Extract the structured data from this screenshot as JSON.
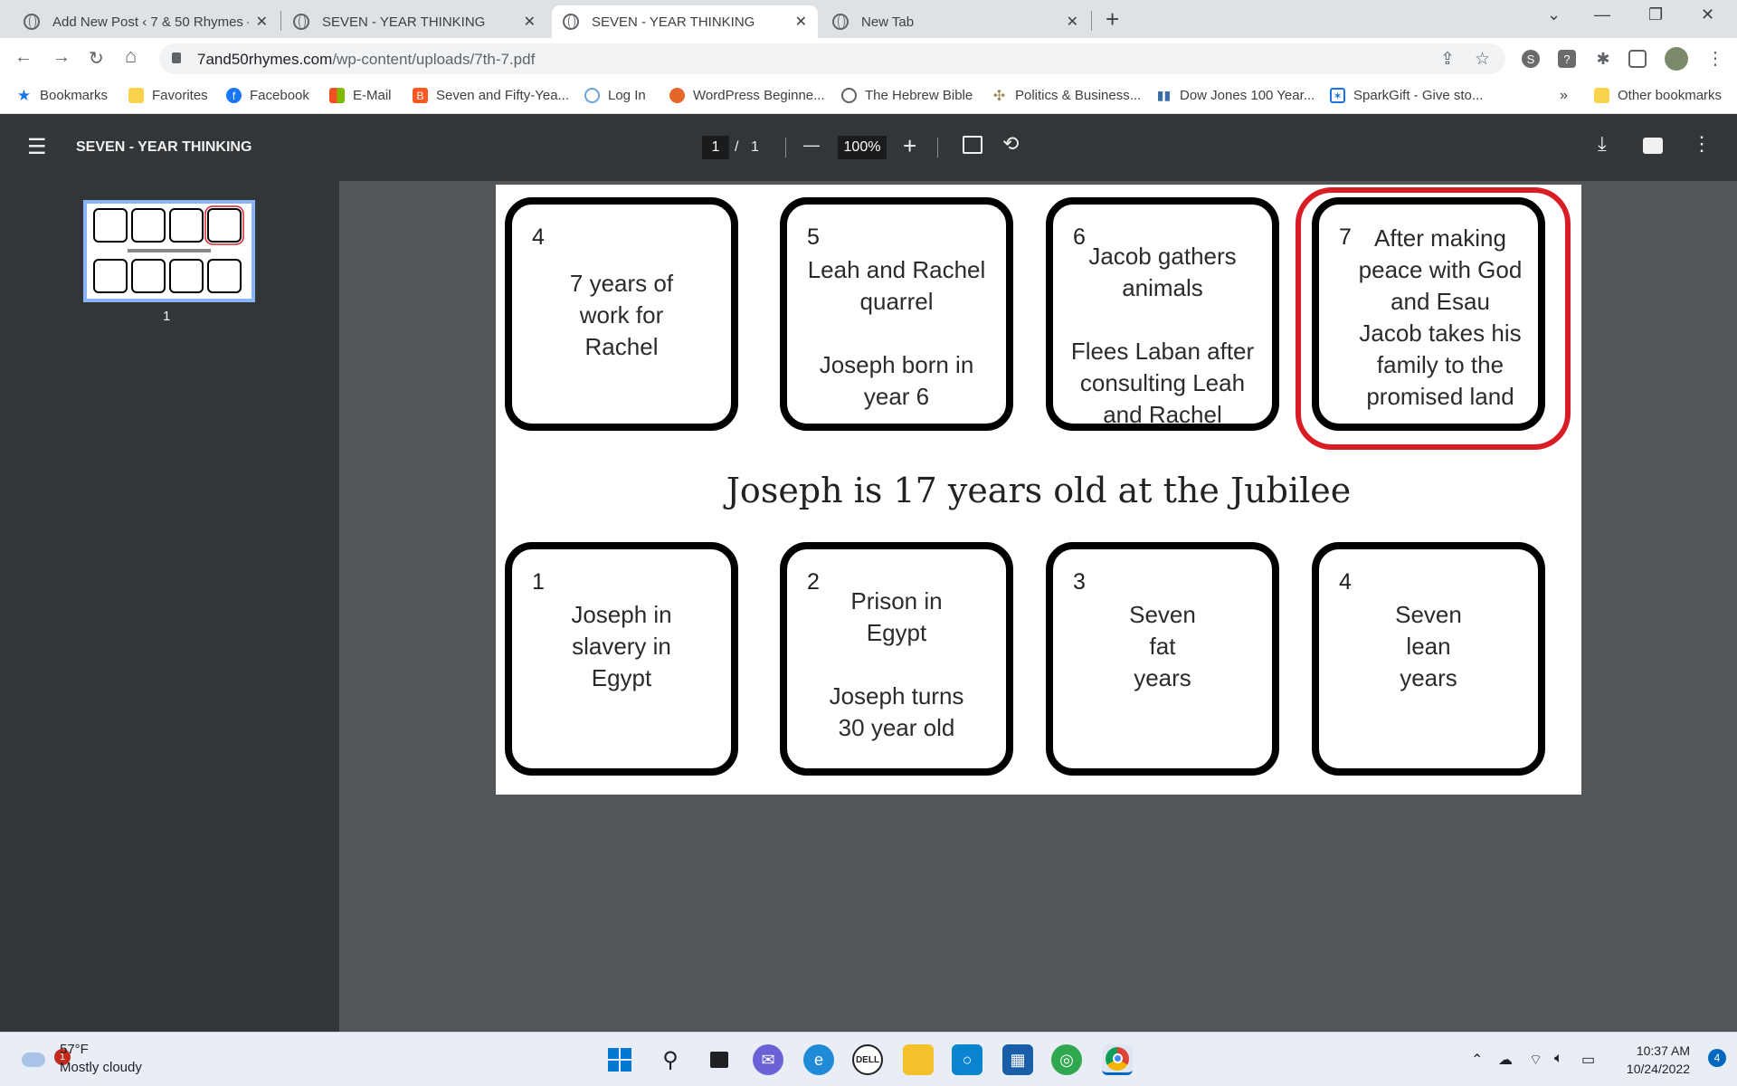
{
  "tabs": [
    {
      "title": "Add New Post ‹ 7 & 50 Rhymes –",
      "close": "✕"
    },
    {
      "title": "SEVEN - YEAR THINKING",
      "close": "✕"
    },
    {
      "title": "SEVEN - YEAR THINKING",
      "close": "✕",
      "active": true
    },
    {
      "title": "New Tab",
      "close": "✕"
    }
  ],
  "new_tab": "+",
  "window_controls": {
    "dropdown": "⌄",
    "minimize": "—",
    "restore": "❐",
    "close": "✕"
  },
  "address": {
    "host": "7and50rhymes.com",
    "path": "/wp-content/uploads/7th-7.pdf"
  },
  "nav": {
    "back": "←",
    "forward": "→",
    "reload": "↻",
    "home": "⌂"
  },
  "bookmarks": [
    {
      "label": "Bookmarks",
      "icon": "star-icon",
      "color": "#1a73e8"
    },
    {
      "label": "Favorites",
      "icon": "folder-icon",
      "color": "#f9d34b"
    },
    {
      "label": "Facebook",
      "icon": "facebook-icon",
      "color": "#1877f2"
    },
    {
      "label": "E-Mail",
      "icon": "microsoft-icon",
      "color": "#f25022"
    },
    {
      "label": "Seven and Fifty-Yea...",
      "icon": "blogger-icon",
      "color": "#ff5722"
    },
    {
      "label": "Log In",
      "icon": "wordpress-icon",
      "color": "#6aa5d8"
    },
    {
      "label": "WordPress Beginne...",
      "icon": "wpbeginner-icon",
      "color": "#e5662a"
    },
    {
      "label": "The Hebrew Bible",
      "icon": "globe-icon",
      "color": "#5f6368"
    },
    {
      "label": "Politics & Business...",
      "icon": "politics-icon",
      "color": "#9c8a5a"
    },
    {
      "label": "Dow Jones 100 Year...",
      "icon": "chart-icon",
      "color": "#3a6ea5"
    },
    {
      "label": "SparkGift - Give sto...",
      "icon": "sparkgift-icon",
      "color": "#1a73e8"
    }
  ],
  "bookmarks_more": "»",
  "other_bookmarks": "Other bookmarks",
  "pdf": {
    "title": "SEVEN - YEAR THINKING",
    "page_current": "1",
    "page_sep": "/",
    "page_total": "1",
    "zoom": "100%",
    "zoom_out": "—",
    "zoom_in": "+",
    "thumb_label": "1"
  },
  "document": {
    "top_cards": [
      {
        "num": "4",
        "text": "7 years of\nwork for\nRachel"
      },
      {
        "num": "5",
        "text": "Leah and Rachel\nquarrel\n\nJoseph born in\nyear 6"
      },
      {
        "num": "6",
        "text": "Jacob gathers\nanimals\n\nFlees Laban after\nconsulting Leah\nand Rachel"
      },
      {
        "num": "7",
        "text": "After making\npeace with God\nand Esau\nJacob takes his\nfamily to the\npromised land"
      }
    ],
    "heading": "Joseph is 17 years old at the Jubilee",
    "bottom_cards": [
      {
        "num": "1",
        "text": "Joseph in\nslavery in\nEgypt"
      },
      {
        "num": "2",
        "text": "Prison in\nEgypt\n\nJoseph turns\n30 year old"
      },
      {
        "num": "3",
        "text": "Seven\nfat\nyears"
      },
      {
        "num": "4",
        "text": "Seven\nlean\nyears"
      }
    ],
    "highlight_color": "#d81e24"
  },
  "taskbar": {
    "weather_temp": "57°F",
    "weather_desc": "Mostly cloudy",
    "weather_badge": "1",
    "time": "10:37 AM",
    "date": "10/24/2022",
    "notifications": "4"
  }
}
